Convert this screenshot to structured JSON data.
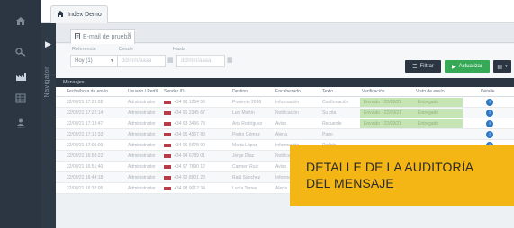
{
  "window": {
    "tab_label": "Index Demo"
  },
  "rail": {
    "icons": [
      "home-icon",
      "tools-icon",
      "factory-icon",
      "table-icon",
      "user-download-icon"
    ]
  },
  "strip": {
    "vertical_label": "Navigator"
  },
  "subtab": {
    "label": "E-mail de prueba"
  },
  "filters": {
    "label_1": "Referencia",
    "label_2": "Desde",
    "label_3": "Hasta",
    "select_value": "Hoy (1)",
    "date_from_placeholder": "dd/mm/aaaa",
    "date_to_placeholder": "dd/mm/aaaa"
  },
  "toolbar": {
    "filter_label": "Filtrar",
    "apply_label": "Actualizar",
    "extra_label": ""
  },
  "results": {
    "title": "Mensajes"
  },
  "table": {
    "columns": [
      "Fecha/hora de envío",
      "Usuario / Perfil",
      "Sender ID",
      "Destino",
      "Encabezado",
      "Texto",
      "Verificación",
      "Visto de envío",
      "Detalle"
    ],
    "rows": [
      {
        "date": "22/09/21 17:28:02",
        "user": "Administrador",
        "sender": "+34 98 1234 56",
        "dest": "Poniente 2090",
        "head": "Información",
        "text": "Confirmación",
        "green": true,
        "verif": "Enviado · 22/09/21",
        "seen": "Entregado"
      },
      {
        "date": "22/09/21 17:22:14",
        "user": "Administrador",
        "sender": "+34 91 2345 67",
        "dest": "Luis Martín",
        "head": "Notificación",
        "text": "Su cita",
        "green": true,
        "verif": "Enviado · 22/09/21",
        "seen": "Entregado"
      },
      {
        "date": "22/09/21 17:18:47",
        "user": "Administrador",
        "sender": "+34 93 3456 78",
        "dest": "Ana Rodríguez",
        "head": "Aviso",
        "text": "Recuerde",
        "green": true,
        "verif": "Enviado · 22/09/21",
        "seen": "Entregado"
      },
      {
        "date": "22/09/21 17:12:33",
        "user": "Administrador",
        "sender": "+34 95 4567 89",
        "dest": "Pedro Gómez",
        "head": "Alerta",
        "text": "Pago",
        "green": false,
        "verif": "",
        "seen": ""
      },
      {
        "date": "22/09/21 17:05:09",
        "user": "Administrador",
        "sender": "+34 96 5678 90",
        "dest": "Marta López",
        "head": "Información",
        "text": "Pedido",
        "green": false,
        "verif": "",
        "seen": ""
      },
      {
        "date": "22/09/21 16:58:22",
        "user": "Administrador",
        "sender": "+34 94 6789 01",
        "dest": "Jorge Díaz",
        "head": "Notificación",
        "text": "Envío",
        "green": false,
        "verif": "",
        "seen": ""
      },
      {
        "date": "22/09/21 16:51:40",
        "user": "Administrador",
        "sender": "+34 97 7890 12",
        "dest": "Carmen Ruiz",
        "head": "Aviso",
        "text": "Factura",
        "green": false,
        "verif": "",
        "seen": ""
      },
      {
        "date": "22/09/21 16:44:18",
        "user": "Administrador",
        "sender": "+34 92 8901 23",
        "dest": "Raúl Sánchez",
        "head": "Información",
        "text": "Estado",
        "green": false,
        "verif": "",
        "seen": ""
      },
      {
        "date": "22/09/21 16:37:05",
        "user": "Administrador",
        "sender": "+34 98 9012 34",
        "dest": "Lucía Torres",
        "head": "Alerta",
        "text": "Código",
        "green": true,
        "verif": "Enviado · 22/09/21",
        "seen": "Entregado"
      }
    ]
  },
  "callout": {
    "line_1": "DETALLE DE LA AUDITORÍA",
    "line_2": "DEL MENSAJE"
  },
  "colors": {
    "rail_bg": "#2b3642",
    "accent_green": "#35a956",
    "verified_cell": "#c6e5b5",
    "callout": "#f3b615",
    "flag_red": "#b63c48",
    "info_blue": "#2f77c0"
  }
}
